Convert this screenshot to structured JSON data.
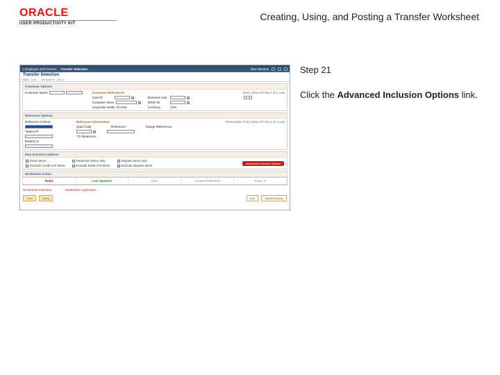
{
  "header": {
    "logo_text": "ORACLE",
    "logo_sub": "USER PRODUCTIVITY KIT",
    "doc_title": "Creating, Using, and Posting a Transfer Worksheet"
  },
  "step": {
    "label": "Step 21",
    "pre_text": "Click the ",
    "bold_text": "Advanced Inclusion Options",
    "post_text": " link."
  },
  "thumb": {
    "nav_back": "< Employee Self Service",
    "nav_title": "Transfer Selection",
    "nav_right": "New Window",
    "page_title": "Transfer Selection",
    "crumb1": "BBB . Unit .",
    "crumb2": "Worksheet .  Run 1 .",
    "status_right": "",
    "sec1": {
      "head": "Customer Options",
      "sub_head": "Customer References",
      "pager": "Find | View All    First 1 of 1 Last",
      "f1": "Customer Name",
      "f2": "Cust ID",
      "f3": "Customer Items",
      "f4": "Business Unit",
      "f5": "Corporate SetID",
      "f5v": "SHARE",
      "f6": "MICR ID",
      "f7": "Currency",
      "f7v": "USD"
    },
    "sec2": {
      "head": "Reference Options",
      "sub_head": "Reference Information",
      "pager": "Personalize  Find | View All      First  1 of 1   Last",
      "f1": "Reference Criteria",
      "f1v": "Specific Value",
      "f2": "Qual Code",
      "f3": "Reference",
      "f4": "Range References",
      "f5": "*Match Pt",
      "f6": "*To Reference",
      "f7": "Restrict to"
    },
    "sec3": {
      "head": "Item Inclusion Options",
      "c1": "Exact Items",
      "c2": "Deduction Items only",
      "c3": "Dispute Items only",
      "c4": "Exclude Credit Amt Items",
      "c5": "Exclude Debit Amt Items",
      "c6": "Exclude Dispute Items",
      "adv": "Advanced Inclusion Options"
    },
    "sec4": {
      "head": "Worksheet Action",
      "tab1": "Build",
      "tab2": "Last Updated",
      "tab3": "User",
      "tab4": "Created Date/Time",
      "tab5": "Rows: 0"
    },
    "sec5": {
      "label": "Worksheet Selection",
      "t2": "Worksheet Application",
      "btn1": "Save",
      "btn2": "Notify",
      "btn3": "Add",
      "btn4": "Update/Display"
    }
  }
}
